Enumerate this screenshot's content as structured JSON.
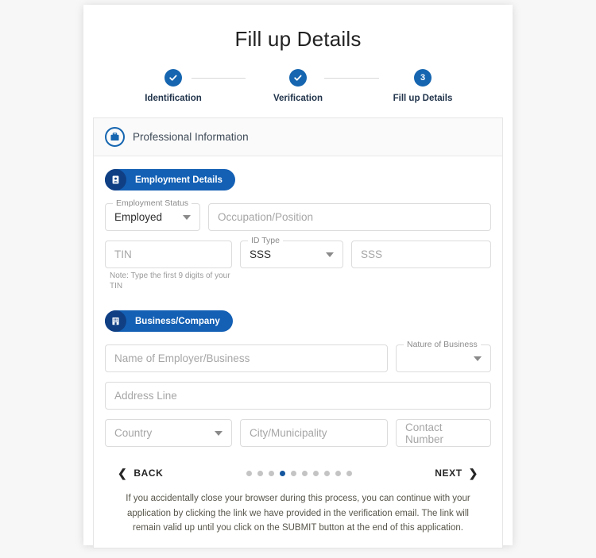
{
  "header": {
    "title": "Fill up Details",
    "steps": [
      {
        "label": "Identification",
        "state": "done",
        "marker": "check-icon"
      },
      {
        "label": "Verification",
        "state": "done",
        "marker": "check-icon"
      },
      {
        "label": "Fill up Details",
        "state": "current",
        "marker": "3"
      }
    ]
  },
  "panel": {
    "heading": "Professional Information",
    "heading_icon": "briefcase-icon",
    "sections": [
      {
        "badge": {
          "label": "Employment Details",
          "icon": "id-card-icon"
        },
        "fields": [
          {
            "name": "employment-status",
            "kind": "select",
            "label": "Employment Status",
            "value": "Employed"
          },
          {
            "name": "occupation-position",
            "kind": "input",
            "placeholder": "Occupation/Position",
            "value": ""
          },
          {
            "name": "tin",
            "kind": "input",
            "placeholder": "TIN",
            "value": "",
            "note": "Note: Type the first 9 digits of your TIN"
          },
          {
            "name": "id-type",
            "kind": "select",
            "label": "ID Type",
            "value": "SSS"
          },
          {
            "name": "id-number",
            "kind": "input",
            "placeholder": "SSS",
            "value": ""
          }
        ]
      },
      {
        "badge": {
          "label": "Business/Company",
          "icon": "building-icon"
        },
        "fields": [
          {
            "name": "employer-business-name",
            "kind": "input",
            "placeholder": "Name of Employer/Business",
            "value": ""
          },
          {
            "name": "nature-of-business",
            "kind": "select",
            "label": "Nature of Business",
            "value": ""
          },
          {
            "name": "address-line",
            "kind": "input",
            "placeholder": "Address Line",
            "value": ""
          },
          {
            "name": "country",
            "kind": "select",
            "placeholder": "Country",
            "value": ""
          },
          {
            "name": "city-municipality",
            "kind": "input",
            "placeholder": "City/Municipality",
            "value": ""
          },
          {
            "name": "contact-number",
            "kind": "input",
            "placeholder": "Contact Number",
            "value": ""
          }
        ]
      }
    ]
  },
  "footer": {
    "back_label": "BACK",
    "next_label": "NEXT",
    "back_chevron": "chevron-left-icon",
    "next_chevron": "chevron-right-icon",
    "dots_total": 10,
    "dots_active_index": 4,
    "disclaimer": "If you accidentally close your browser during this process, you can continue with your application by clicking the link we have provided in the verification email. The link will remain valid up until you click on the SUBMIT button at the end of this application."
  },
  "colors": {
    "accent_blue": "#1565b0",
    "badge_blue": "#1360b5",
    "badge_icon_navy": "#103f84",
    "dot_active": "#14569e",
    "dot_inactive": "#c4c4c4",
    "page_bg": "#f7f7f7",
    "disclaimer_text": "#57554a"
  }
}
